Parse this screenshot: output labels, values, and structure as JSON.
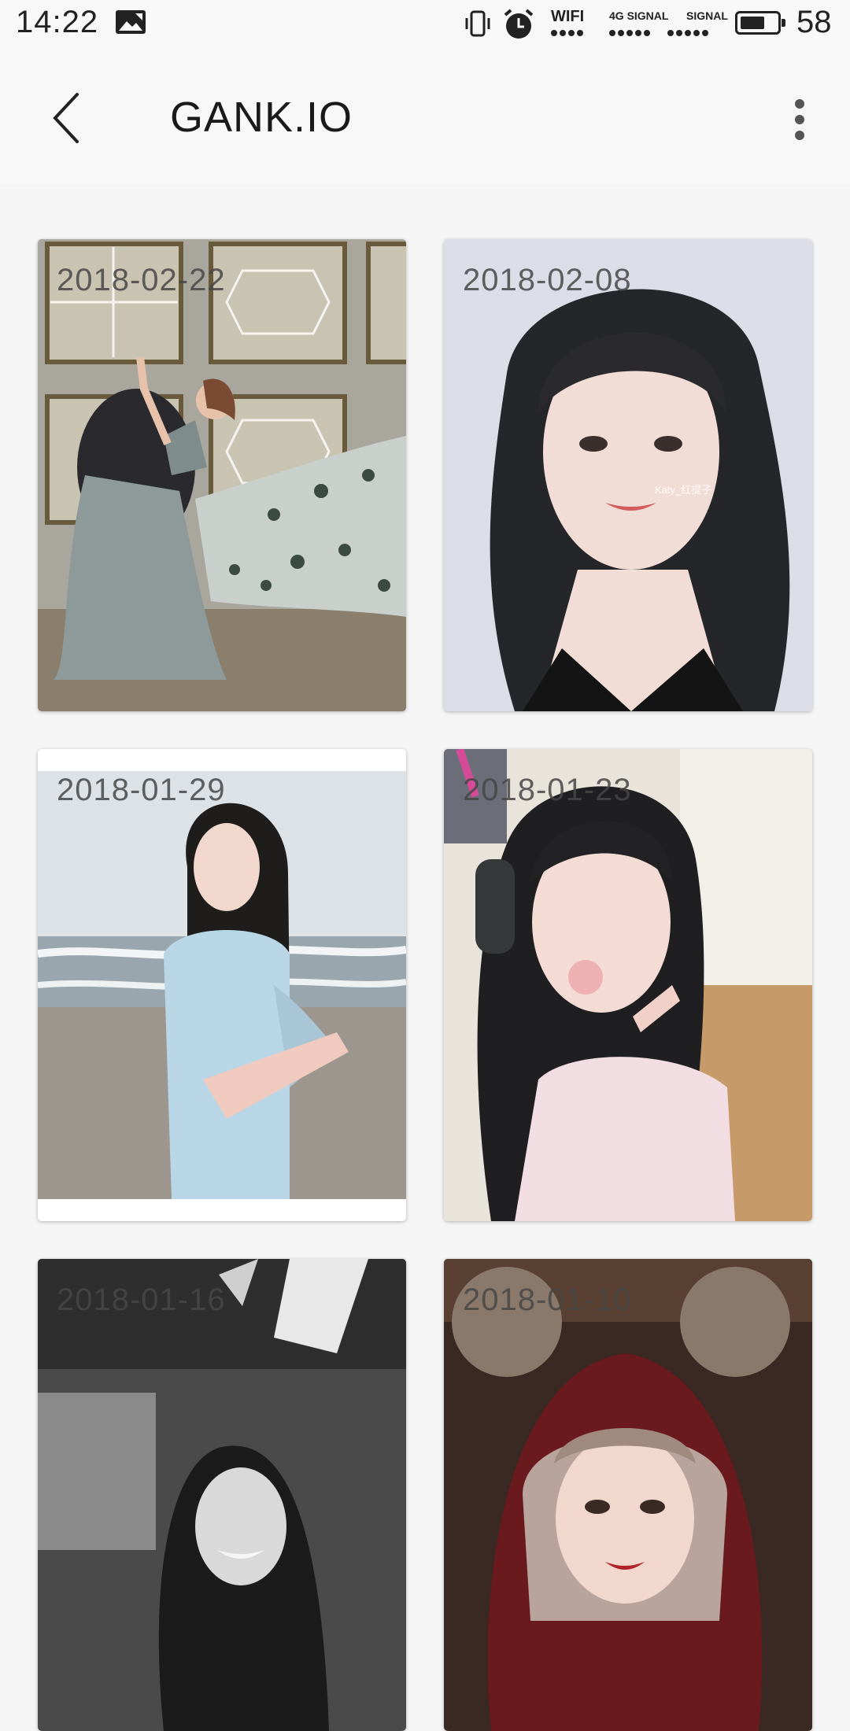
{
  "status_bar": {
    "time": "14:22",
    "gallery_notification_icon": "image-icon",
    "vibrate_icon": "vibrate-icon",
    "alarm_icon": "alarm-icon",
    "wifi_label": "WIFI",
    "signal1_label": "4G SIGNAL",
    "signal2_label": "SIGNAL",
    "battery_icon": "battery-icon",
    "battery_level": "58"
  },
  "toolbar": {
    "back_icon": "back-arrow-icon",
    "title": "GANK.IO",
    "overflow_icon": "more-vertical-icon"
  },
  "cards": [
    {
      "date": "2018-02-22",
      "scene": "window room, lace gown"
    },
    {
      "date": "2018-02-08",
      "scene": "portrait, bangs"
    },
    {
      "date": "2018-01-29",
      "scene": "seaside, light blue sweater"
    },
    {
      "date": "2018-01-23",
      "scene": "headphones, pink jacket"
    },
    {
      "date": "2018-01-16",
      "scene": "black and white train"
    },
    {
      "date": "2018-01-10",
      "scene": "fur ears hood"
    }
  ],
  "watermark": "Katy_红提子",
  "colors": {
    "background": "#f5f5f5",
    "toolbar": "#f8f8f8",
    "text_primary": "#1a1a1a"
  }
}
